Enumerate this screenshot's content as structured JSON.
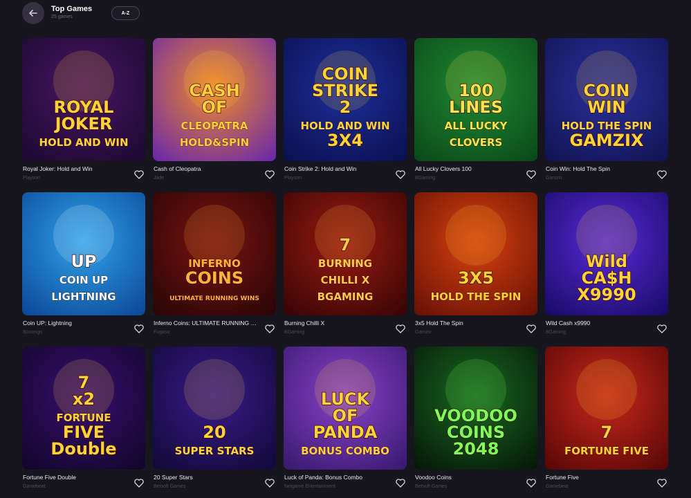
{
  "header": {
    "title": "Top Games",
    "subtitle": "25 games",
    "sort_label": "A-Z"
  },
  "games": [
    {
      "name": "Royal Joker: Hold and Win",
      "provider": "Playson",
      "art_lines": [
        "ROYAL",
        "JOKER",
        "HOLD AND WIN"
      ],
      "colors": {
        "bg1": "#4a1560",
        "bg2": "#1c0a33",
        "text": "#ffd23a"
      }
    },
    {
      "name": "Cash of Cleopatra",
      "provider": "Jade",
      "art_lines": [
        "CASH",
        "OF",
        "CLEOPATRA",
        "HOLD&SPIN"
      ],
      "colors": {
        "bg1": "#f28a28",
        "bg2": "#6b2aa8",
        "text": "#ffcf3a"
      }
    },
    {
      "name": "Coin Strike 2: Hold and Win",
      "provider": "Playson",
      "art_lines": [
        "COIN",
        "STRIKE",
        "2",
        "HOLD AND WIN",
        "3X4"
      ],
      "colors": {
        "bg1": "#1d2f9a",
        "bg2": "#0b1152",
        "text": "#ffd23a"
      }
    },
    {
      "name": "All Lucky Clovers 100",
      "provider": "BGaming",
      "art_lines": [
        "100",
        "LINES",
        "ALL LUCKY",
        "CLOVERS"
      ],
      "colors": {
        "bg1": "#1e8a32",
        "bg2": "#0c4a1a",
        "text": "#ffe14a"
      }
    },
    {
      "name": "Coin Win: Hold The Spin",
      "provider": "Gamzix",
      "art_lines": [
        "COIN",
        "WIN",
        "HOLD THE SPIN",
        "GAMZIX"
      ],
      "colors": {
        "bg1": "#2b2f9e",
        "bg2": "#121552",
        "text": "#ffd23a"
      }
    },
    {
      "name": "Coin UP: Lightning",
      "provider": "Booongo",
      "art_lines": [
        "UP",
        "COIN UP",
        "LIGHTNING"
      ],
      "colors": {
        "bg1": "#2fa2e8",
        "bg2": "#0d4a9a",
        "text": "#ffffff"
      }
    },
    {
      "name": "Inferno Coins: ULTIMATE RUNNING WINS",
      "provider": "Fugaso",
      "art_lines": [
        "INFERNO",
        "COINS",
        "ULTIMATE RUNNING WINS"
      ],
      "colors": {
        "bg1": "#7a1310",
        "bg2": "#2a0606",
        "text": "#ffb23a"
      }
    },
    {
      "name": "Burning Chilli X",
      "provider": "BGaming",
      "art_lines": [
        "7",
        "BURNING",
        "CHILLI X",
        "BGAMING"
      ],
      "colors": {
        "bg1": "#9a1a10",
        "bg2": "#3a0606",
        "text": "#ffc94a"
      }
    },
    {
      "name": "3x5 Hold The Spin",
      "provider": "Gamzix",
      "art_lines": [
        "3X5",
        "HOLD THE SPIN"
      ],
      "colors": {
        "bg1": "#d8420e",
        "bg2": "#6a1206",
        "text": "#ffd23a"
      }
    },
    {
      "name": "Wild Cash x9990",
      "provider": "BGaming",
      "art_lines": [
        "Wild",
        "CA$H",
        "X9990"
      ],
      "colors": {
        "bg1": "#5a2ad8",
        "bg2": "#1a0c6a",
        "text": "#ffd23a"
      }
    },
    {
      "name": "Fortune Five Double",
      "provider": "Gamebeat",
      "art_lines": [
        "7",
        "x2",
        "FORTUNE",
        "FIVE",
        "Double"
      ],
      "colors": {
        "bg1": "#3a0f72",
        "bg2": "#12062a",
        "text": "#ffd23a"
      }
    },
    {
      "name": "20 Super Stars",
      "provider": "Betsoft Games",
      "art_lines": [
        "20",
        "SUPER STARS"
      ],
      "colors": {
        "bg1": "#3a1a8a",
        "bg2": "#120a3a",
        "text": "#ffd23a"
      }
    },
    {
      "name": "Luck of Panda: Bonus Combo",
      "provider": "Netgame Entertainment",
      "art_lines": [
        "LUCK",
        "OF",
        "PANDA",
        "BONUS COMBO"
      ],
      "colors": {
        "bg1": "#8a42c8",
        "bg2": "#3a1a72",
        "text": "#ffd23a"
      }
    },
    {
      "name": "Voodoo Coins",
      "provider": "Betsoft Games",
      "art_lines": [
        "VOODOO",
        "COINS",
        "2048"
      ],
      "colors": {
        "bg1": "#1a6a22",
        "bg2": "#061a08",
        "text": "#7dff5a"
      }
    },
    {
      "name": "Fortune Five",
      "provider": "Gamebeat",
      "art_lines": [
        "7",
        "FORTUNE FIVE"
      ],
      "colors": {
        "bg1": "#c8281a",
        "bg2": "#5a0808",
        "text": "#ffd23a"
      }
    }
  ]
}
